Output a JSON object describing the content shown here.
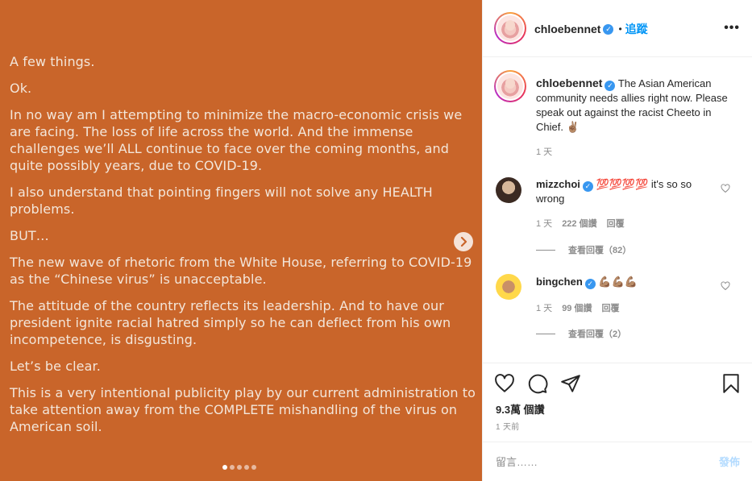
{
  "post": {
    "paragraphs": [
      "A few things.",
      "Ok.",
      "In no way am I attempting to minimize the macro-economic crisis we are facing. The loss of life across the world. And the immense challenges we’ll ALL continue to face over the coming months, and quite possibly years, due to COVID-19.",
      "I also understand that pointing fingers will not solve any HEALTH problems.",
      "BUT…",
      "The new wave of rhetoric from the White House, referring to COVID-19 as the “Chinese virus” is unacceptable.",
      "The attitude of the country reflects its leadership. And to have our president ignite racial hatred simply so he can deflect from his own incompetence, is disgusting.",
      "Let’s be clear.",
      "This is a very intentional publicity play by our current administration to take attention away from the COMPLETE mishandling of the virus on American soil."
    ],
    "background_color": "#c9652a",
    "carousel_total": 5,
    "carousel_active": 1
  },
  "header": {
    "username": "chloebennet",
    "separator": "•",
    "follow_label": "追蹤",
    "more_icon": "more-dots-icon"
  },
  "caption": {
    "username": "chloebennet",
    "text": "The Asian American community needs allies right now. Please speak out against the racist Cheeto in Chief. ✌🏽",
    "time": "1 天"
  },
  "comments": [
    {
      "username": "mizzchoi",
      "text": "💯💯💯💯 it's so so wrong",
      "time": "1 天",
      "likes": "222 個讚",
      "reply_label": "回覆",
      "view_replies": "查看回覆（82）"
    },
    {
      "username": "bingchen",
      "text": "💪🏽💪🏽💪🏽",
      "time": "1 天",
      "likes": "99 個讚",
      "reply_label": "回覆",
      "view_replies": "查看回覆（2）"
    }
  ],
  "actions": {
    "likes": "9.3萬 個讚",
    "time": "1 天前"
  },
  "comment_box": {
    "placeholder": "留言……",
    "post_label": "發佈"
  }
}
